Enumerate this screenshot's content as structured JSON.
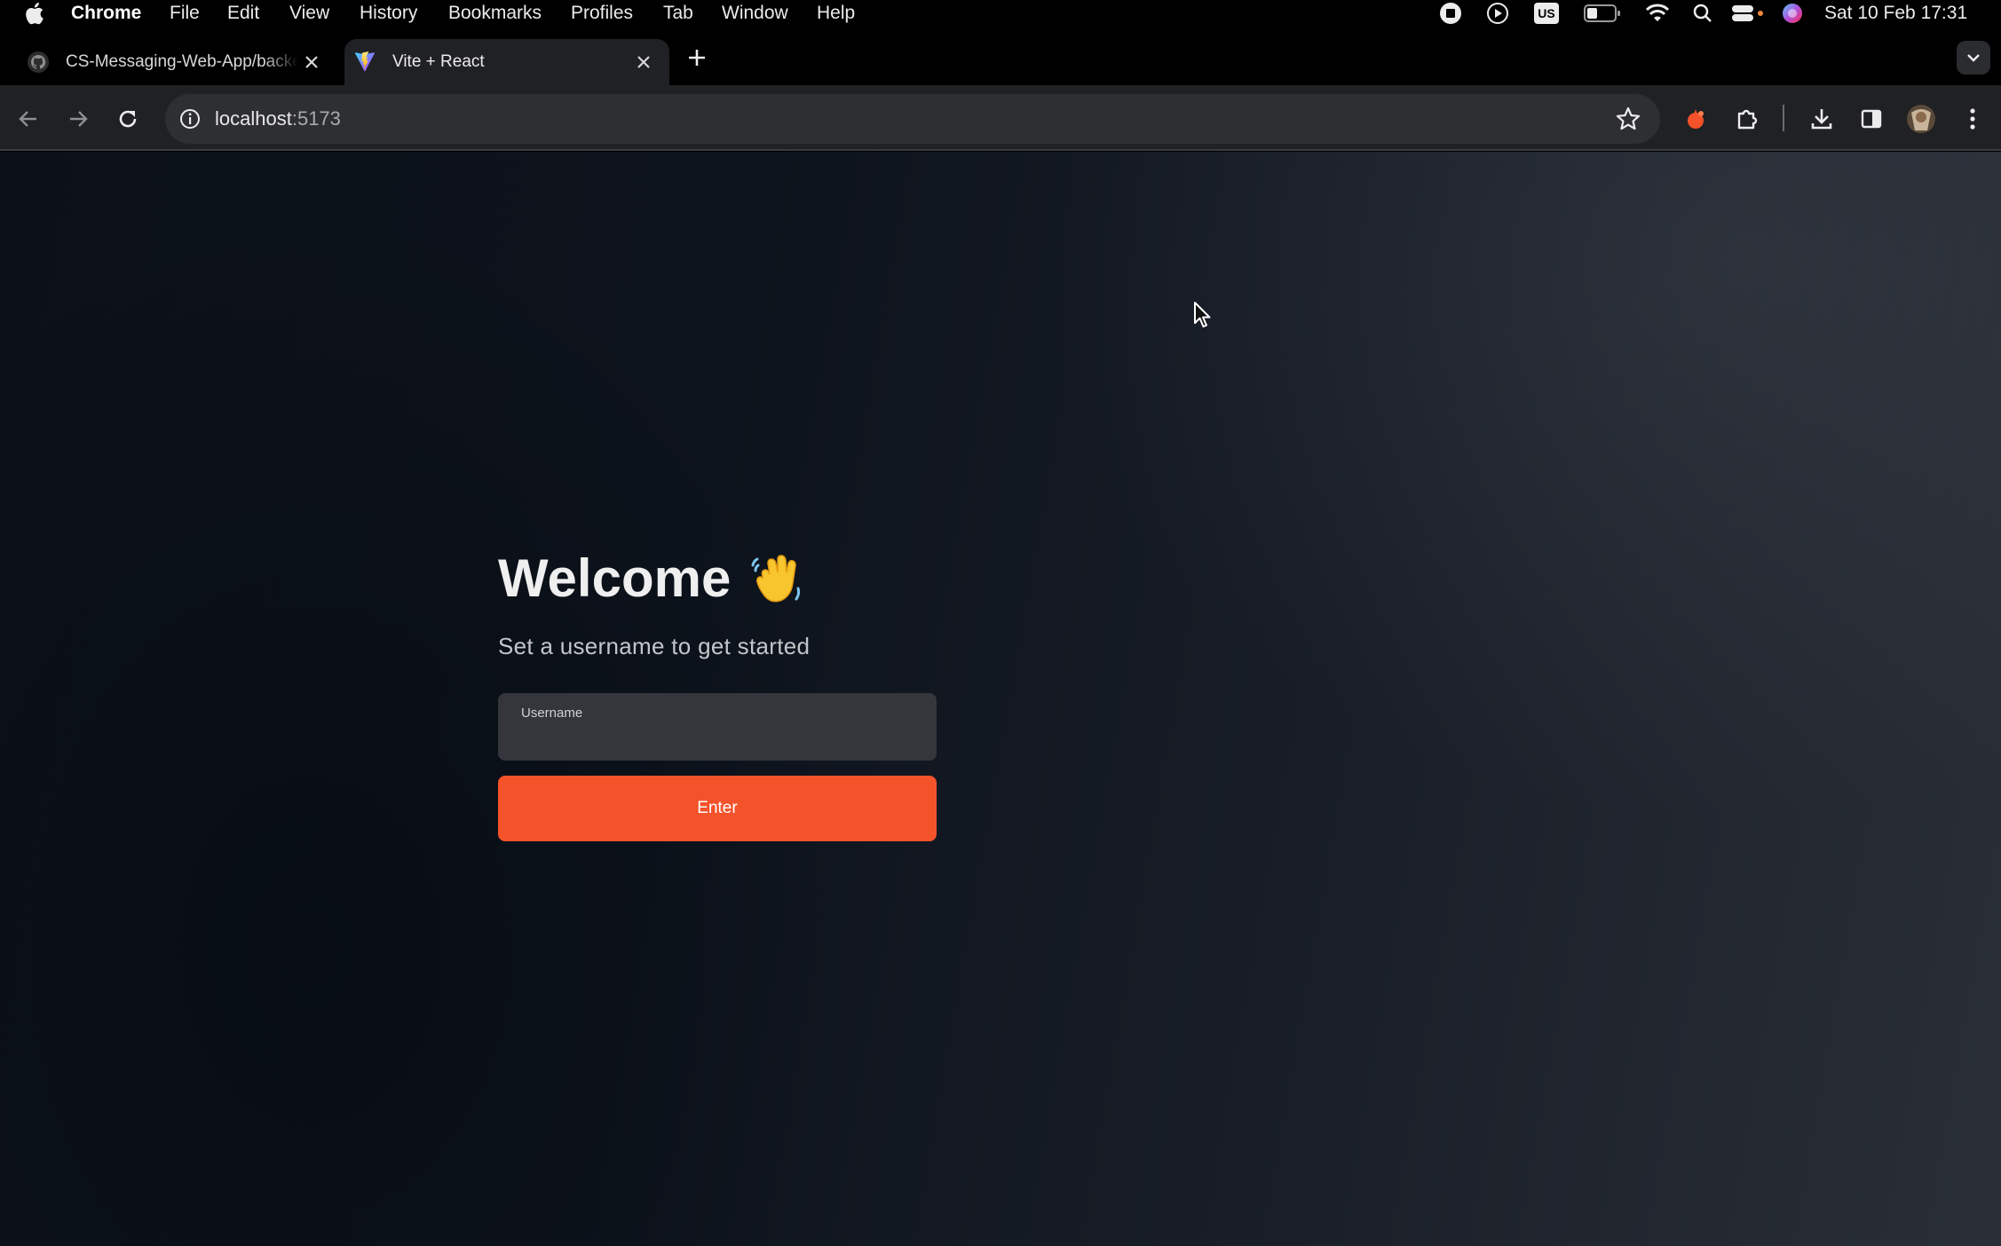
{
  "menubar": {
    "app_name": "Chrome",
    "items": [
      "File",
      "Edit",
      "View",
      "History",
      "Bookmarks",
      "Profiles",
      "Tab",
      "Window",
      "Help"
    ],
    "input_source": "US",
    "datetime": "Sat 10 Feb  17:31"
  },
  "tabs": [
    {
      "title": "CS-Messaging-Web-App/backend",
      "favicon": "github-icon",
      "active": false
    },
    {
      "title": "Vite + React",
      "favicon": "vite-icon",
      "active": true
    }
  ],
  "toolbar": {
    "url_host": "localhost",
    "url_port": ":5173"
  },
  "page": {
    "title": "Welcome",
    "title_emoji": "waving-hand-icon",
    "subtitle": "Set a username to get started",
    "username_label": "Username",
    "username_value": "",
    "enter_label": "Enter"
  },
  "colors": {
    "accent": "#f4522a",
    "input_bg": "#34363c",
    "page_bg_dark": "#0c1119",
    "page_bg_light": "#2a2f37"
  }
}
